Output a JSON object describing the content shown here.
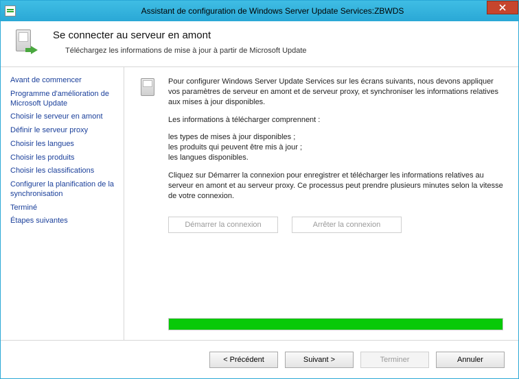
{
  "window": {
    "title": "Assistant de configuration de Windows Server Update Services:ZBWDS"
  },
  "header": {
    "title": "Se connecter au serveur en amont",
    "subtitle": "Téléchargez les informations de mise à jour à partir de Microsoft Update"
  },
  "sidebar": {
    "items": [
      "Avant de commencer",
      "Programme d'amélioration de Microsoft Update",
      "Choisir le serveur en amont",
      "Définir le serveur proxy",
      "Choisir les langues",
      "Choisir les produits",
      "Choisir les classifications",
      "Configurer la planification de la synchronisation",
      "Terminé",
      "Étapes suivantes"
    ]
  },
  "content": {
    "para1": "Pour configurer Windows Server Update Services sur les écrans suivants, nous devons appliquer vos paramètres de serveur en amont et de serveur proxy, et synchroniser les informations relatives aux mises à jour disponibles.",
    "para2": "Les informations à télécharger comprennent :",
    "bullet1": "les types de mises à jour disponibles ;",
    "bullet2": "les produits qui peuvent être mis à jour ;",
    "bullet3": "les langues disponibles.",
    "para3": "Cliquez sur Démarrer la connexion pour enregistrer et télécharger les informations relatives au serveur en amont et au serveur proxy. Ce processus peut prendre plusieurs minutes selon la vitesse de votre connexion.",
    "start_button": "Démarrer la connexion",
    "stop_button": "Arrêter la connexion",
    "progress_percent": 100
  },
  "footer": {
    "back": "< Précédent",
    "next": "Suivant >",
    "finish": "Terminer",
    "cancel": "Annuler"
  }
}
